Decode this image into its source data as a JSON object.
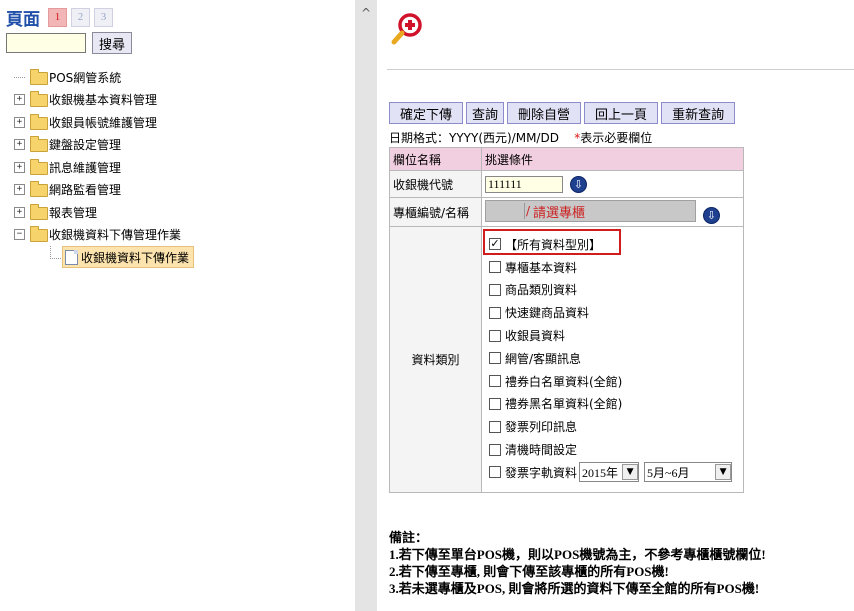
{
  "left": {
    "pager": {
      "title": "頁面",
      "pages": [
        "1",
        "2",
        "3"
      ],
      "active": "1"
    },
    "search": {
      "value": "",
      "button": "搜尋"
    },
    "tree": {
      "root": "POS網管系統",
      "items": [
        "收銀機基本資料管理",
        "收銀員帳號維護管理",
        "鍵盤設定管理",
        "訊息維護管理",
        "網路監看管理",
        "報表管理",
        "收銀機資料下傳管理作業"
      ],
      "expander_plus": "+",
      "expander_minus": "−",
      "child": "收銀機資料下傳作業"
    }
  },
  "splitter": {
    "scroll_icon": "^"
  },
  "right": {
    "actions": [
      "確定下傳",
      "查詢",
      "刪除自營",
      "回上一頁",
      "重新查詢"
    ],
    "date_format": "日期格式：YYYY(西元)/MM/DD",
    "required_note": "* 表示必要欄位",
    "table": {
      "col_header": "欄位名稱",
      "cond_header": "挑選條件",
      "pos_code_label": "收銀機代號",
      "pos_code_value": "111111",
      "cabinet_label": "專櫃編號/名稱",
      "cabinet_sep": "/",
      "cabinet_placeholder": "請選專櫃",
      "data_type_label": "資料類別",
      "types": [
        "【所有資料型別】",
        "專櫃基本資料",
        "商品類別資料",
        "快速鍵商品資料",
        "收銀員資料",
        "網管/客顯訊息",
        "禮券白名單資料(全館)",
        "禮券黑名單資料(全館)",
        "發票列印訊息",
        "清機時間設定",
        "發票字軌資料"
      ],
      "checked_mark": "✓",
      "year_select": "2015年",
      "period_select": "5月~6月",
      "select_arrow": "▼",
      "lookup_icon": "⇩"
    },
    "remarks": {
      "title": "備註：",
      "lines": [
        "1.若下傳至單台POS機，則以POS機號為主，不參考專櫃櫃號欄位!",
        "2.若下傳至專櫃, 則會下傳至該專櫃的所有POS機!",
        "3.若未選專櫃及POS, 則會將所選的資料下傳至全館的所有POS機!"
      ]
    }
  },
  "colors": {
    "header_pink": "#f2cfe0",
    "button_lavender": "#e2e2f6",
    "highlight_red": "#d01c1c",
    "input_yellow": "#ffffe6"
  }
}
